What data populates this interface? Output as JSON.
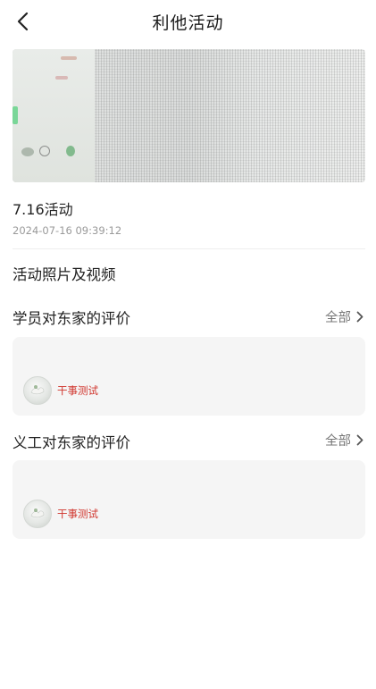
{
  "header": {
    "title": "利他活动"
  },
  "event": {
    "name": "7.16活动",
    "time": "2024-07-16 09:39:12"
  },
  "media_section": {
    "title": "活动照片及视频"
  },
  "student_reviews": {
    "title": "学员对东家的评价",
    "more_label": "全部",
    "reviewer_name": "干事测试"
  },
  "volunteer_reviews": {
    "title": "义工对东家的评价",
    "more_label": "全部",
    "reviewer_name": "干事测试"
  },
  "colors": {
    "accent_red": "#d0342c",
    "card_bg": "#f5f5f5",
    "muted_text": "#9a9a9a"
  },
  "icons": {
    "back": "back-arrow-icon",
    "more": "chevron-right-icon"
  }
}
